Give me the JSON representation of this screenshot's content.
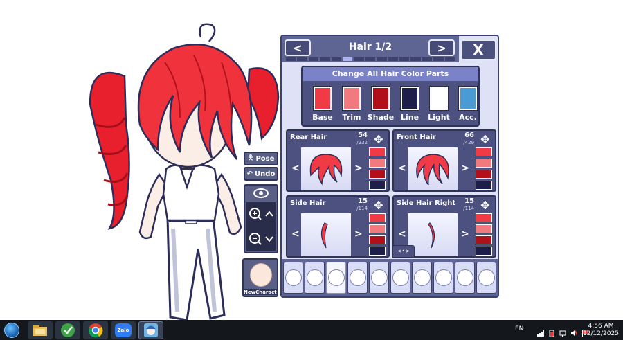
{
  "character": {
    "hair_color": "#f0323c",
    "skin_color": "#fbeee7",
    "outline_color": "#2d2d5a"
  },
  "tools": {
    "pose_label": "Pose",
    "undo_label": "Undo",
    "new_character_label": "NewCharacte"
  },
  "panel": {
    "title": "Hair 1/2",
    "close_glyph": "X",
    "prev_glyph": "<",
    "next_glyph": ">",
    "page_count": 15,
    "active_page": 5
  },
  "colors": {
    "title": "Change All Hair Color Parts",
    "swatches": [
      {
        "label": "Base",
        "color": "#f03a46"
      },
      {
        "label": "Trim",
        "color": "#f27a7f"
      },
      {
        "label": "Shade",
        "color": "#b10f19"
      },
      {
        "label": "Line",
        "color": "#1d1f4a"
      },
      {
        "label": "Light",
        "color": "#ffffff"
      },
      {
        "label": "Acc.",
        "color": "#4a9ad6"
      }
    ]
  },
  "hair_parts": [
    {
      "name": "Rear Hair",
      "value": "54",
      "total": "/232"
    },
    {
      "name": "Front Hair",
      "value": "66",
      "total": "/429"
    },
    {
      "name": "Side Hair",
      "value": "15",
      "total": "/114"
    },
    {
      "name": "Side Hair Right",
      "value": "15",
      "total": "/114"
    }
  ],
  "mini_swatches": [
    "#f03a46",
    "#f27a7f",
    "#b10f19",
    "#1d1f4a"
  ],
  "scroll_handle_label": "<•>",
  "categories": [
    "body-preset",
    "body",
    "hair",
    "face",
    "eyes",
    "eyebrows",
    "outfit",
    "pants",
    "accessories",
    "profile"
  ],
  "active_category": 2,
  "taskbar": {
    "lang": "EN",
    "time": "4:56 AM",
    "date": "12/12/2025",
    "zalo_label": "Zalo"
  }
}
